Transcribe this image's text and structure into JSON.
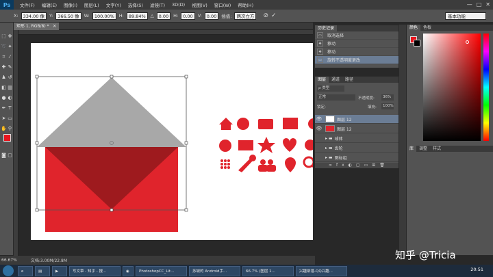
{
  "app": {
    "logo": "Ps"
  },
  "menubar": {
    "items": [
      "文件(F)",
      "编辑(E)",
      "图像(I)",
      "图层(L)",
      "文字(Y)",
      "选择(S)",
      "滤镜(T)",
      "3D(D)",
      "视图(V)",
      "窗口(W)",
      "帮助(H)"
    ]
  },
  "window_controls": {
    "minimize": "—",
    "maximize": "□",
    "close": "✕"
  },
  "options_bar": {
    "x_label": "X:",
    "x_value": "334.00 像",
    "y_label": "Y:",
    "y_value": "366.50 像",
    "w_label": "W:",
    "w_value": "100.00%",
    "h_label": "H:",
    "h_value": "89.84%",
    "angle_label": "△",
    "angle_value": "0.00",
    "h_skew_label": "H:",
    "h_skew_value": "0.00",
    "v_skew_label": "V:",
    "v_skew_value": "0.00",
    "interp_label": "插值:",
    "interp_value": "两次立方",
    "cancel_icon": "⊘",
    "commit_icon": "✓",
    "workspace": "基本功能"
  },
  "document": {
    "tab_title": "矩形 1, RGB/8) *",
    "close": "×"
  },
  "status": {
    "zoom": "66.67%",
    "doc_size": "文档:3.00M/22.8M"
  },
  "history": {
    "tabs": [
      "历史记录"
    ],
    "items": [
      "取消选择",
      "移动",
      "移动",
      "旋转不透明度更改"
    ],
    "selected_index": 3
  },
  "layers": {
    "tabs": [
      "图层",
      "通道",
      "路径"
    ],
    "filter_label": "ρ 类型",
    "blend_mode": "正常",
    "opacity_label": "不透明度:",
    "opacity_value": "36%",
    "lock_label": "锁定:",
    "fill_label": "填充:",
    "fill_value": "100%",
    "rows": [
      {
        "name": "图层 12",
        "type": "layer",
        "selected": true
      },
      {
        "name": "图层 12",
        "type": "layer",
        "selected": false
      },
      {
        "name": "球体",
        "type": "group",
        "selected": false
      },
      {
        "name": "齿轮",
        "type": "group",
        "selected": false
      },
      {
        "name": "图标组",
        "type": "group",
        "selected": false
      }
    ]
  },
  "color_panel": {
    "tabs": [
      "颜色",
      "色板"
    ],
    "fg_color": "#e8151e",
    "bg_color": "#000000"
  },
  "adjust_panel": {
    "tabs": [
      "库",
      "调整",
      "样式"
    ]
  },
  "colors": {
    "red": "#e0242c",
    "darkred": "#9e1a1e",
    "gray": "#a8a8a8"
  },
  "taskbar": {
    "tasks": [
      "写文章 - 知乎 - 搜...",
      "PhotoshopCC_Lit...",
      "苏城的 Android手...",
      "66.7% (图层 1...",
      "兴趣部落-QQ兴趣..."
    ],
    "clock": "20:51"
  },
  "watermark": "知乎 @Tricia"
}
